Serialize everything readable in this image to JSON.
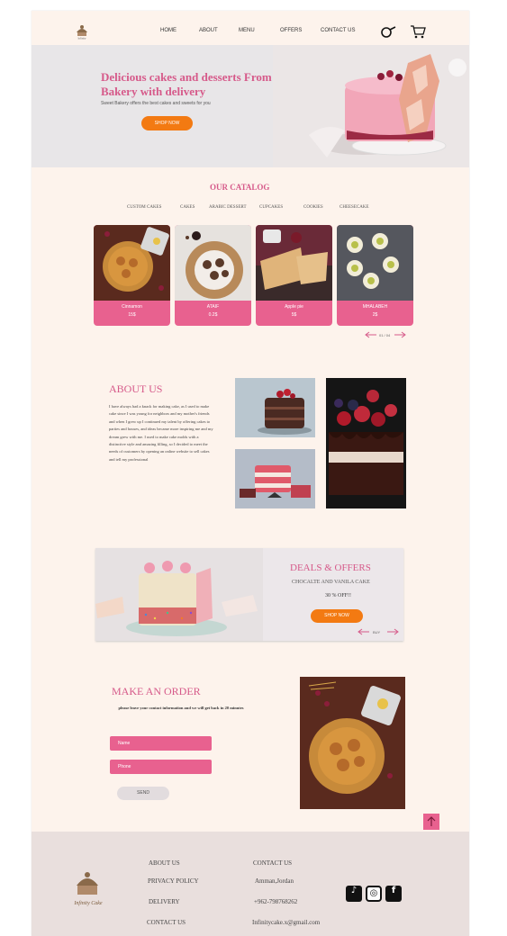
{
  "header": {
    "nav": [
      "HOME",
      "ABOUT",
      "MENU",
      "OFFERS",
      "CONTACT US"
    ]
  },
  "hero": {
    "title": "Delicious cakes and desserts From Bakery with delivery",
    "subtitle": "Sweet Bakery offers the best cakes and sweets for you",
    "button": "SHOP NOW"
  },
  "catalog": {
    "title": "OUR CATALOG",
    "tabs": [
      "CUSTOM CAKES",
      "CAKES",
      "ARABIC DESSERT",
      "CUPCAKES",
      "COOKIES",
      "CHEESECAKE"
    ],
    "items": [
      {
        "name": "Cinnamon",
        "price": "15$"
      },
      {
        "name": "ATAIF",
        "price": "0.2$"
      },
      {
        "name": "Apple pie",
        "price": "5$"
      },
      {
        "name": "MHALABEH",
        "price": "2$"
      }
    ],
    "pager": "01 / 04"
  },
  "about": {
    "title": "ABOUT US",
    "text": "I have always had a knack for making cake, as I used to make cake since I was young for neighbors and my mother's friends and when I grew up I continued my talent by offering cakes to parties and houses, and ideas became more inspiring me and my dream grew with me. I used to make cake molds with a distinctive style and amazing filling, so I decided to meet the needs of customers by opening an online website to sell cakes and tell my professional"
  },
  "deals": {
    "title": "DEALS & OFFERS",
    "product": "CHOCALTE AND VANILA CAKE",
    "discount": "30 % OFF!!",
    "button": "SHOP NOW",
    "link": "BUY"
  },
  "order": {
    "title": "MAKE AN ORDER",
    "subtitle": "please leave your contact information and we will get back in 20 minutes",
    "name_placeholder": "Name",
    "phone_placeholder": "Phone",
    "send": "SEND"
  },
  "footer": {
    "brand": "Infinity Cake",
    "links": [
      "ABOUT US",
      "PRIVACY POLICY",
      "DELIVERY",
      "CONTACT US"
    ],
    "contact_title": "CONTACT US",
    "address": "Amman,Jordan",
    "phone": "+962-798768262",
    "email": "Infinitycake.x@gmail.com"
  },
  "colors": {
    "accent_pink": "#e8618f",
    "title_pink": "#d65a8a",
    "orange": "#f37a12",
    "page_bg": "#fdf3ec"
  }
}
